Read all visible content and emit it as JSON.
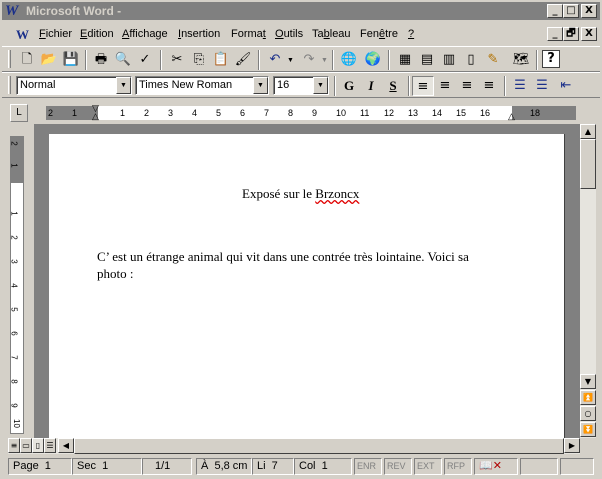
{
  "window": {
    "title": "Microsoft Word -",
    "app_icon": "W",
    "caption_buttons": [
      "_",
      "□",
      "X"
    ],
    "doc_buttons": [
      "_",
      "🗗",
      "X"
    ]
  },
  "menubar": {
    "doc_icon": "W",
    "items": [
      {
        "accel": "F",
        "rest": "ichier"
      },
      {
        "accel": "E",
        "rest": "dition"
      },
      {
        "accel": "A",
        "rest": "ffichage"
      },
      {
        "accel": "I",
        "rest": "nsertion"
      },
      {
        "pre": "Forma",
        "accel": "t",
        "rest": ""
      },
      {
        "accel": "O",
        "rest": "utils"
      },
      {
        "pre": "Ta",
        "accel": "b",
        "rest": "leau"
      },
      {
        "pre": "Fen",
        "accel": "ê",
        "rest": "tre"
      },
      {
        "accel": "?",
        "rest": ""
      }
    ]
  },
  "standard_toolbar": {
    "icons": [
      "new-icon",
      "open-icon",
      "save-icon",
      "print-icon",
      "print-preview-icon",
      "spelling-icon",
      "cut-icon",
      "copy-icon",
      "paste-icon",
      "format-painter-icon",
      "undo-icon",
      "redo-icon",
      "hyperlink-icon",
      "web-toolbar-icon",
      "tables-borders-icon",
      "insert-table-icon",
      "insert-excel-icon",
      "columns-icon",
      "drawing-icon",
      "document-map-icon",
      "help-icon"
    ],
    "glyphs": [
      "🗋",
      "📂",
      "💾",
      "🖶",
      "🔍",
      "✓",
      "✂",
      "⎘",
      "📋",
      "🖌",
      "↶",
      "↷",
      "🌐",
      "🌍",
      "▦",
      "▤",
      "▥",
      "▯",
      "✎",
      "🗺",
      "?"
    ]
  },
  "formatting_toolbar": {
    "style": "Normal",
    "font": "Times New Roman",
    "size": "16",
    "bold": "G",
    "italic": "I",
    "underline": "S",
    "align_icons": [
      "align-left-icon",
      "align-center-icon",
      "align-right-icon",
      "justify-icon",
      "numbering-icon",
      "bullets-icon",
      "decrease-indent-icon"
    ],
    "align_glyphs": [
      "≡",
      "≡",
      "≡",
      "≡",
      "☰",
      "☰",
      "⇤"
    ]
  },
  "ruler": {
    "tab_selector": "L",
    "numbers": [
      "2",
      "1",
      "1",
      "2",
      "3",
      "4",
      "5",
      "6",
      "7",
      "8",
      "9",
      "10",
      "11",
      "12",
      "13",
      "14",
      "15",
      "16",
      "18"
    ],
    "vertical_numbers": [
      "2",
      "1",
      "1",
      "2",
      "3",
      "4",
      "5",
      "6",
      "7",
      "8",
      "9",
      "10"
    ]
  },
  "document": {
    "heading_prefix": "Exposé sur le ",
    "heading_misspelled": "Brzoncx",
    "para_line1": "C’ est un étrange animal qui vit dans une contrée très lointaine. Voici sa",
    "para_line2": "photo :"
  },
  "statusbar": {
    "page": "Page  1",
    "sec": "Sec  1",
    "pages": "1/1",
    "at": "À  5,8 cm",
    "line": "Li  7",
    "col": "Col  1",
    "modes": [
      "ENR",
      "REV",
      "EXT",
      "RFP"
    ]
  }
}
